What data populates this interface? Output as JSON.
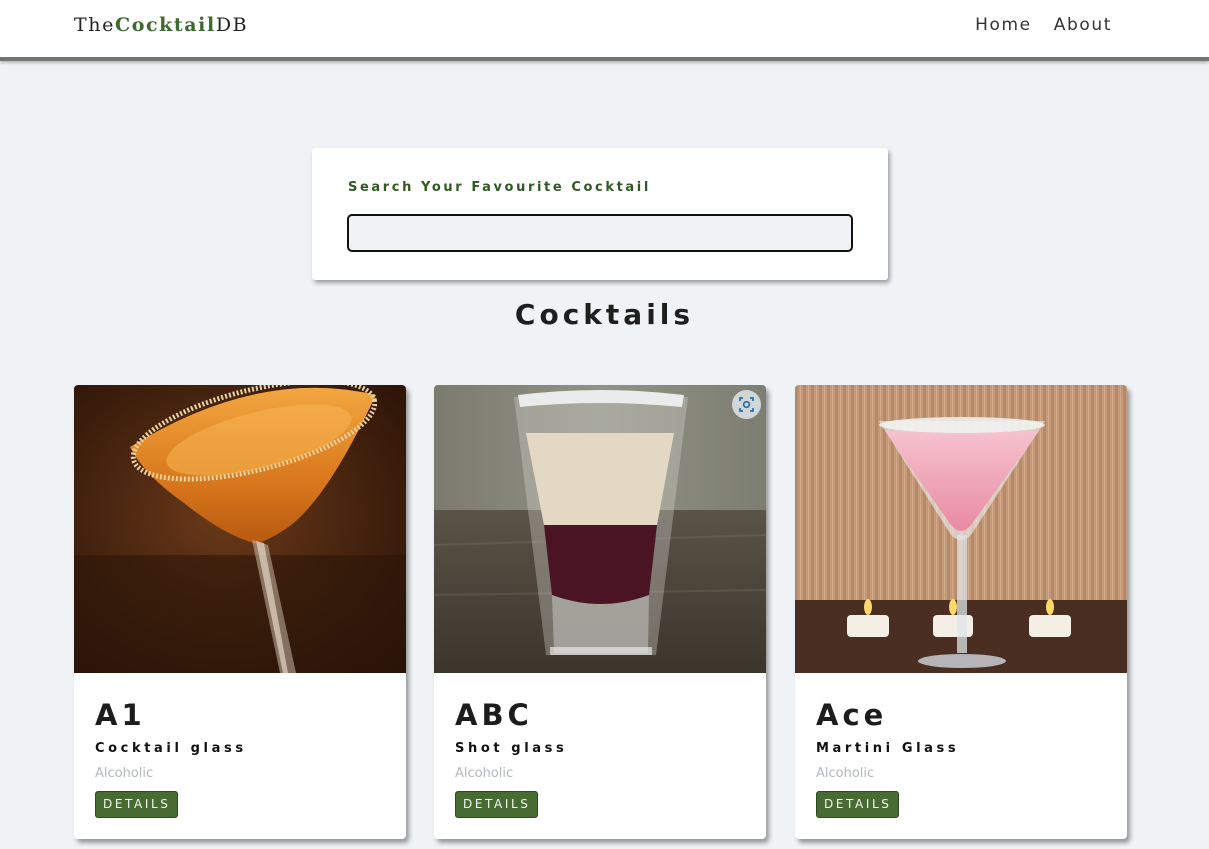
{
  "nav": {
    "logo_prefix": "The",
    "logo_accent": "Cocktail",
    "logo_suffix": "DB",
    "links": [
      "Home",
      "About"
    ]
  },
  "search": {
    "label": "Search Your Favourite Cocktail",
    "value": ""
  },
  "section_title": "Cocktails",
  "cards": [
    {
      "name": "A1",
      "glass": "Cocktail glass",
      "type": "Alcoholic",
      "button": "DETAILS"
    },
    {
      "name": "ABC",
      "glass": "Shot glass",
      "type": "Alcoholic",
      "button": "DETAILS"
    },
    {
      "name": "Ace",
      "glass": "Martini Glass",
      "type": "Alcoholic",
      "button": "DETAILS"
    }
  ],
  "colors": {
    "accent": "#3f6a2f",
    "button": "#476b32",
    "background": "#f0f3f6"
  },
  "icons": {
    "image_overlay": "visual-search-icon"
  }
}
